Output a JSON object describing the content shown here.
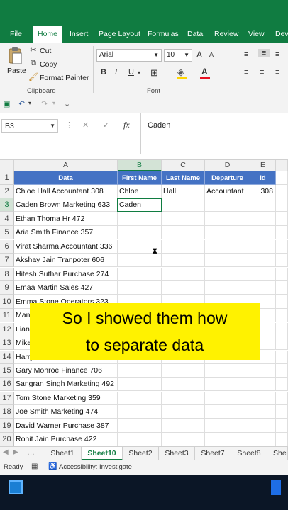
{
  "ribbon_tabs": [
    {
      "label": "File"
    },
    {
      "label": "Home"
    },
    {
      "label": "Insert"
    },
    {
      "label": "Page Layout"
    },
    {
      "label": "Formulas"
    },
    {
      "label": "Data"
    },
    {
      "label": "Review"
    },
    {
      "label": "View"
    },
    {
      "label": "Dev"
    }
  ],
  "clipboard": {
    "paste": "Paste",
    "cut": "Cut",
    "copy": "Copy",
    "format_painter": "Format Painter",
    "group_label": "Clipboard"
  },
  "font": {
    "name": "Arial",
    "size": "10",
    "bold": "B",
    "italic": "I",
    "underline": "U",
    "grow": "A",
    "shrink": "A",
    "font_color": "A",
    "group_label": "Font"
  },
  "formula_bar": {
    "name_box": "B3",
    "fx": "fx",
    "value": "Caden"
  },
  "columns": [
    "A",
    "B",
    "C",
    "D",
    "E"
  ],
  "rows": [
    {
      "n": "1",
      "cells": [
        "Data",
        "First Name",
        "Last Name",
        "Departure",
        "Id"
      ]
    },
    {
      "n": "2",
      "cells": [
        "Chloe Hall Accountant 308",
        "Chloe",
        "Hall",
        "Accountant",
        "308"
      ]
    },
    {
      "n": "3",
      "cells": [
        "Caden Brown Marketing 633",
        "Caden",
        "",
        "",
        ""
      ]
    },
    {
      "n": "4",
      "cells": [
        "Ethan Thoma Hr 472",
        "",
        "",
        "",
        ""
      ]
    },
    {
      "n": "5",
      "cells": [
        "Aria Smith Finance 357",
        "",
        "",
        "",
        ""
      ]
    },
    {
      "n": "6",
      "cells": [
        "Virat Sharma Accountant 336",
        "",
        "",
        "",
        ""
      ]
    },
    {
      "n": "7",
      "cells": [
        "Akshay Jain Tranpoter 606",
        "",
        "",
        "",
        ""
      ]
    },
    {
      "n": "8",
      "cells": [
        "Hitesh Suthar Purchase 274",
        "",
        "",
        "",
        ""
      ]
    },
    {
      "n": "9",
      "cells": [
        "Emaa Martin Sales 427",
        "",
        "",
        "",
        ""
      ]
    },
    {
      "n": "10",
      "cells": [
        "Emma Stone Operators 323",
        "",
        "",
        "",
        ""
      ]
    },
    {
      "n": "11",
      "cells": [
        "Man",
        "",
        "",
        "",
        ""
      ]
    },
    {
      "n": "12",
      "cells": [
        "Lian",
        "",
        "",
        "",
        ""
      ]
    },
    {
      "n": "13",
      "cells": [
        "Mike",
        "",
        "",
        "",
        ""
      ]
    },
    {
      "n": "14",
      "cells": [
        "Harry",
        "",
        "",
        "",
        ""
      ]
    },
    {
      "n": "15",
      "cells": [
        "Gary Monroe Finance 706",
        "",
        "",
        "",
        ""
      ]
    },
    {
      "n": "16",
      "cells": [
        "Sangran Singh Marketing 492",
        "",
        "",
        "",
        ""
      ]
    },
    {
      "n": "17",
      "cells": [
        "Tom Stone Marketing 359",
        "",
        "",
        "",
        ""
      ]
    },
    {
      "n": "18",
      "cells": [
        "Joe Smith Marketing 474",
        "",
        "",
        "",
        ""
      ]
    },
    {
      "n": "19",
      "cells": [
        "David Warner Purchase 387",
        "",
        "",
        "",
        ""
      ]
    },
    {
      "n": "20",
      "cells": [
        "Rohit Jain Purchase 422",
        "",
        "",
        "",
        ""
      ]
    }
  ],
  "caption": {
    "line1": "So I showed them how",
    "line2": "to separate data"
  },
  "sheet_tabs": [
    {
      "label": "Sheet1"
    },
    {
      "label": "Sheet10"
    },
    {
      "label": "Sheet2"
    },
    {
      "label": "Sheet3"
    },
    {
      "label": "Sheet7"
    },
    {
      "label": "Sheet8"
    },
    {
      "label": "She"
    }
  ],
  "status": {
    "ready": "Ready",
    "accessibility": "Accessibility: Investigate"
  },
  "colors": {
    "excel_green": "#107c41",
    "header_blue": "#4472c4",
    "caption_yellow": "#fff200"
  }
}
